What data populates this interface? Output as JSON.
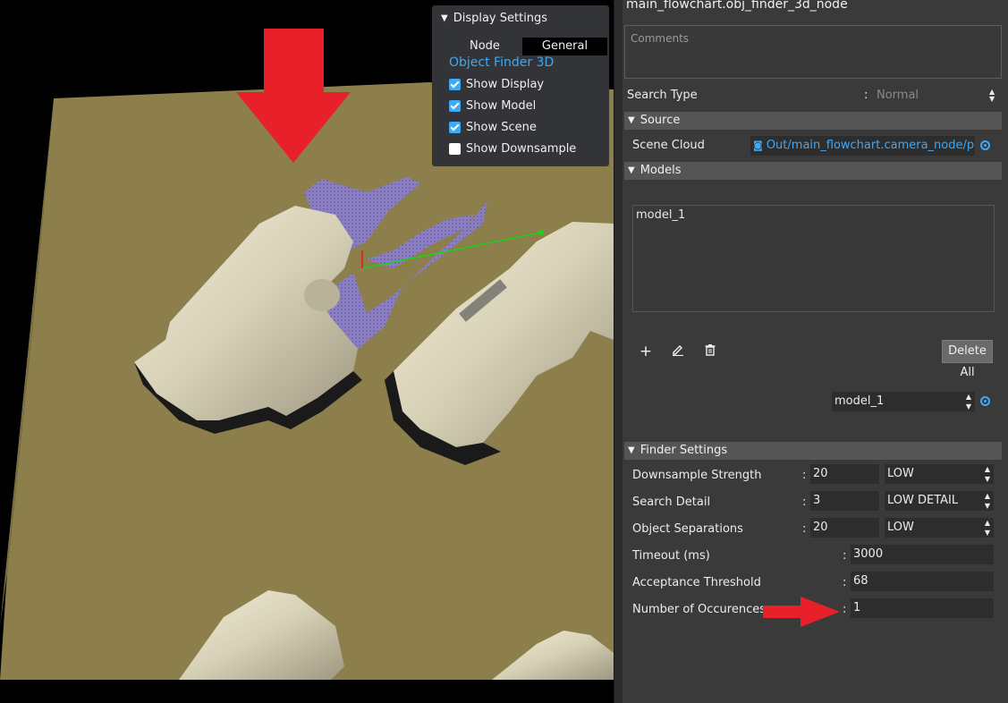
{
  "viewport": {
    "display_settings": {
      "header": "Display Settings",
      "tabs": {
        "node": "Node",
        "general": "General"
      },
      "section_title": "Object Finder 3D",
      "options": [
        {
          "label": "Show Display",
          "checked": true
        },
        {
          "label": "Show Model",
          "checked": true
        },
        {
          "label": "Show Scene",
          "checked": true
        },
        {
          "label": "Show Downsample",
          "checked": false
        }
      ]
    }
  },
  "panel": {
    "title": "main_flowchart.obj_finder_3d_node",
    "comments_placeholder": "Comments",
    "search_type": {
      "label": "Search Type",
      "value": "Normal"
    },
    "source": {
      "header": "Source",
      "scene_cloud": {
        "label": "Scene Cloud",
        "value": "Out/main_flowchart.camera_node/pointC"
      }
    },
    "models": {
      "header": "Models",
      "list": [
        "model_1"
      ],
      "add_icon": "plus-icon",
      "edit_icon": "pencil-icon",
      "delete_icon": "trash-icon",
      "delete_all_label": "Delete All",
      "selected_model": "model_1"
    },
    "finder_settings": {
      "header": "Finder Settings",
      "downsample_strength": {
        "label": "Downsample Strength",
        "value": "20",
        "level": "LOW"
      },
      "search_detail": {
        "label": "Search Detail",
        "value": "3",
        "level": "LOW DETAIL"
      },
      "object_separations": {
        "label": "Object Separations",
        "value": "20",
        "level": "LOW"
      },
      "timeout": {
        "label": "Timeout (ms)",
        "value": "3000"
      },
      "acceptance_threshold": {
        "label": "Acceptance Threshold",
        "value": "68"
      },
      "number_of_occurences": {
        "label": "Number of Occurences",
        "value": "1"
      }
    }
  },
  "colors": {
    "accent": "#3fa9f5",
    "annotation_arrow": "#e8202a",
    "cardboard": "#8c7f4c",
    "pipe": "#d8d2b8",
    "model_points": "#8b7fd6"
  }
}
